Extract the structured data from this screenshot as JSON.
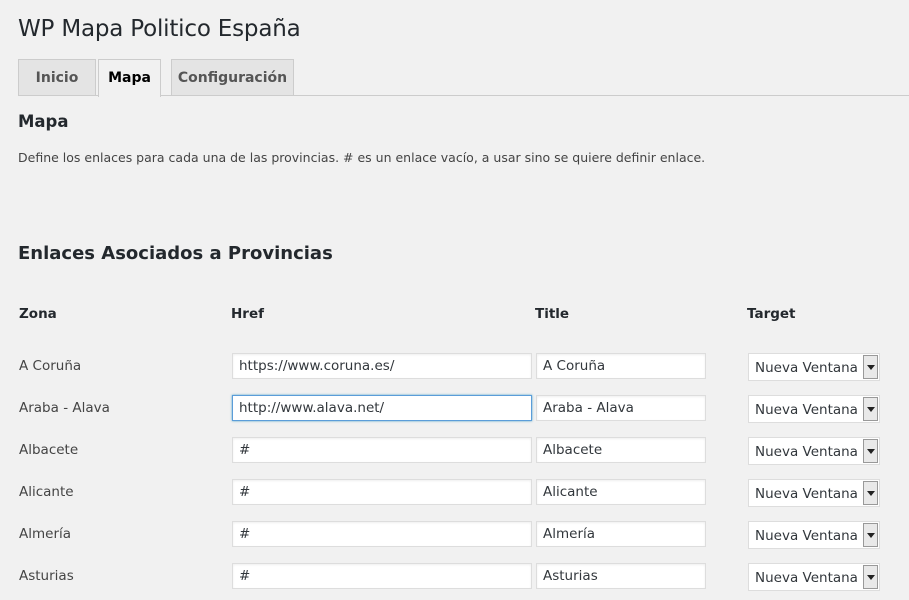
{
  "page_title": "WP Mapa Politico España",
  "tabs": [
    {
      "label": "Inicio",
      "active": false
    },
    {
      "label": "Mapa",
      "active": true
    },
    {
      "label": "Configuración",
      "active": false
    }
  ],
  "section": {
    "title": "Mapa",
    "description": "Define los enlaces para cada una de las provincias. # es un enlace vacío, a usar sino se quiere definir enlace."
  },
  "links_section": {
    "title": "Enlaces Asociados a Provincias",
    "columns": {
      "zona": "Zona",
      "href": "Href",
      "title": "Title",
      "target": "Target"
    },
    "rows": [
      {
        "zona": "A Coruña",
        "href": "https://www.coruna.es/",
        "title": "A Coruña",
        "target": "Nueva Ventana"
      },
      {
        "zona": "Araba - Alava",
        "href": "http://www.alava.net/",
        "title": "Araba - Alava",
        "target": "Nueva Ventana",
        "focused": true
      },
      {
        "zona": "Albacete",
        "href": "#",
        "title": "Albacete",
        "target": "Nueva Ventana"
      },
      {
        "zona": "Alicante",
        "href": "#",
        "title": "Alicante",
        "target": "Nueva Ventana"
      },
      {
        "zona": "Almería",
        "href": "#",
        "title": "Almería",
        "target": "Nueva Ventana"
      },
      {
        "zona": "Asturias",
        "href": "#",
        "title": "Asturias",
        "target": "Nueva Ventana"
      }
    ]
  }
}
